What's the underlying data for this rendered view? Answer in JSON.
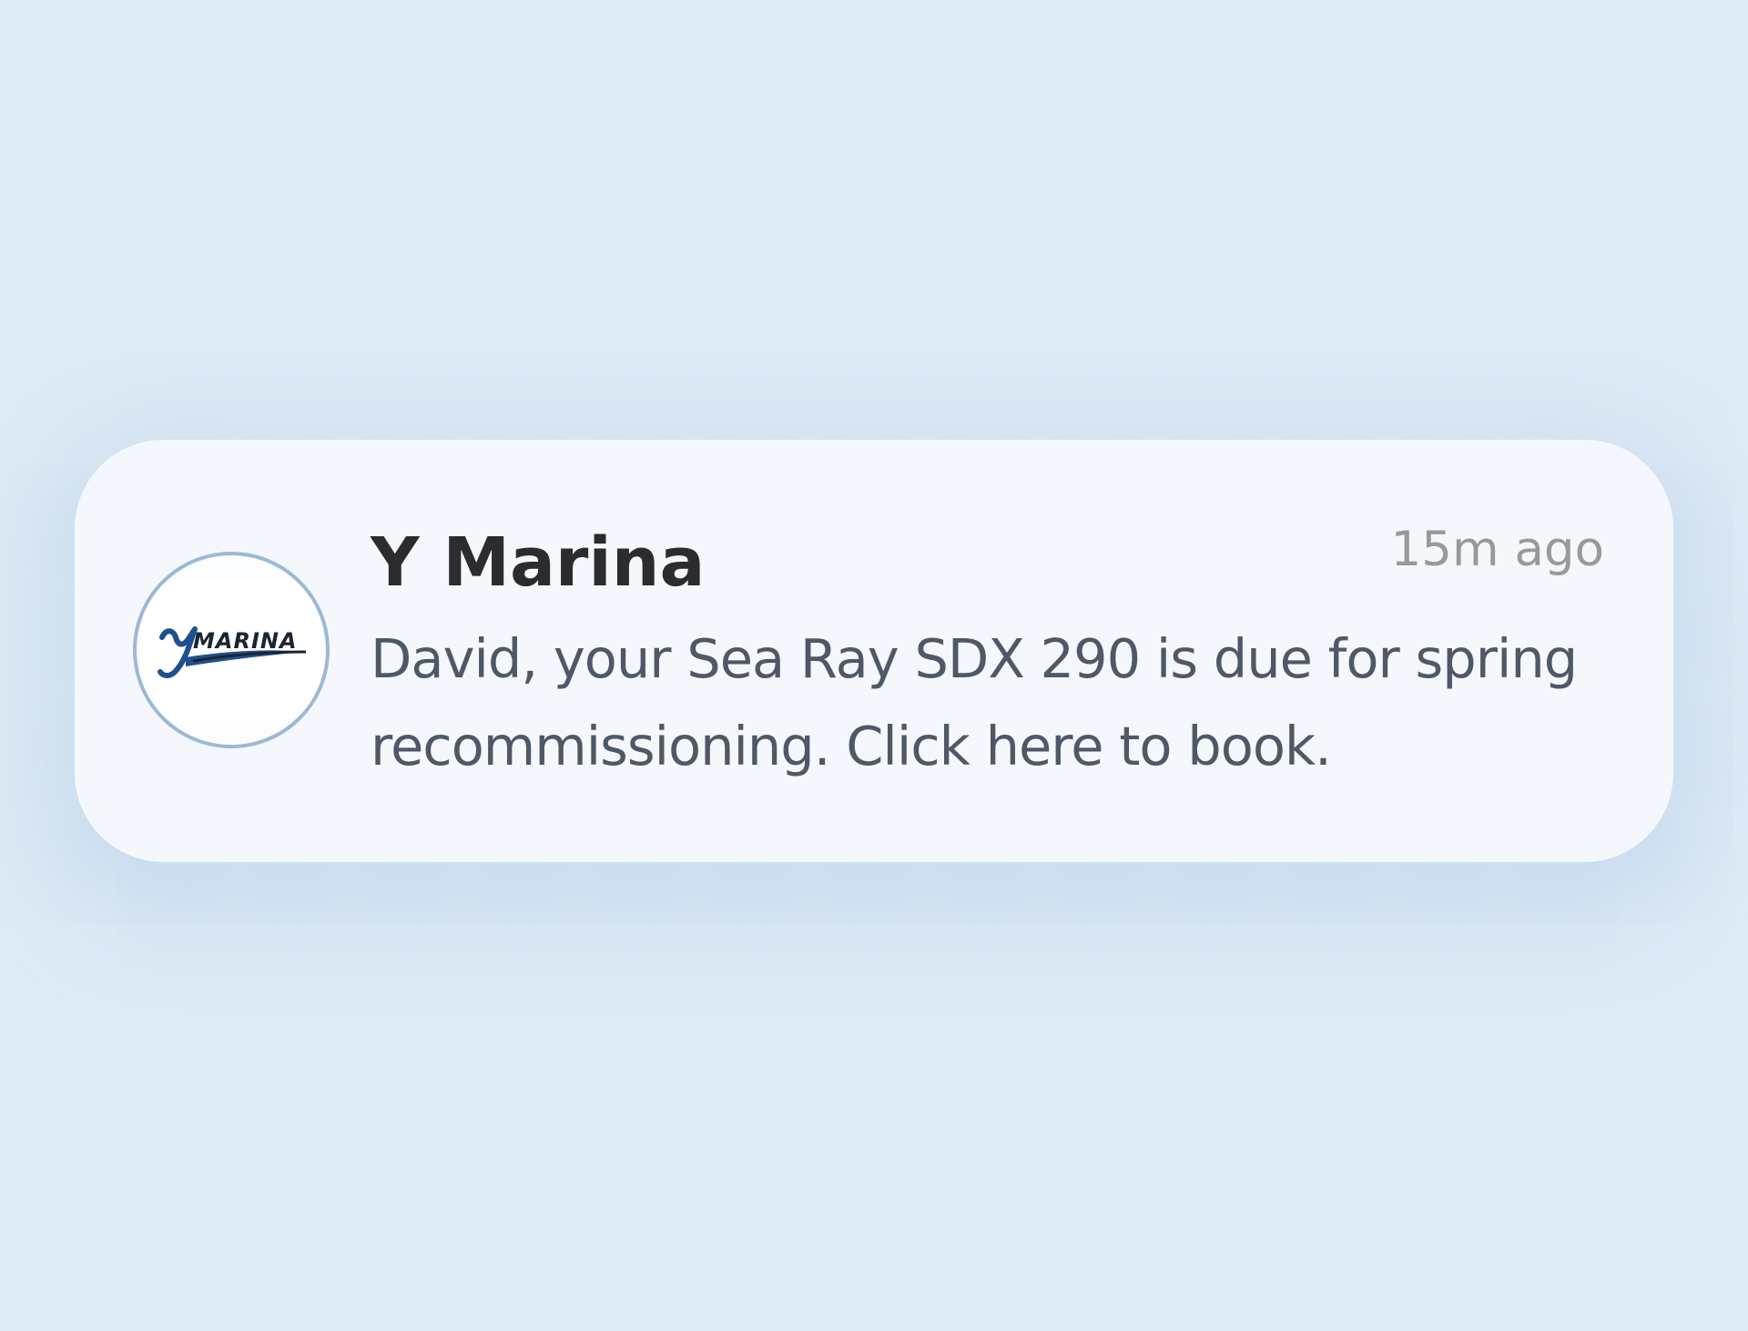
{
  "notification": {
    "app_name": "Y Marina",
    "timestamp": "15m ago",
    "message": "David, your Sea Ray SDX 290 is due for spring recommissioning. Click here to book.",
    "avatar_icon": "y-marina-logo",
    "logo_text": "YMARINA"
  },
  "colors": {
    "background": "#dfebf7",
    "card": "#f4f8fd",
    "title": "#2c2c2e",
    "message": "#4f5866",
    "timestamp": "#97999d",
    "avatar_ring": "#9db8d4",
    "logo_blue": "#1f4f8f",
    "logo_dark": "#1c2430"
  }
}
